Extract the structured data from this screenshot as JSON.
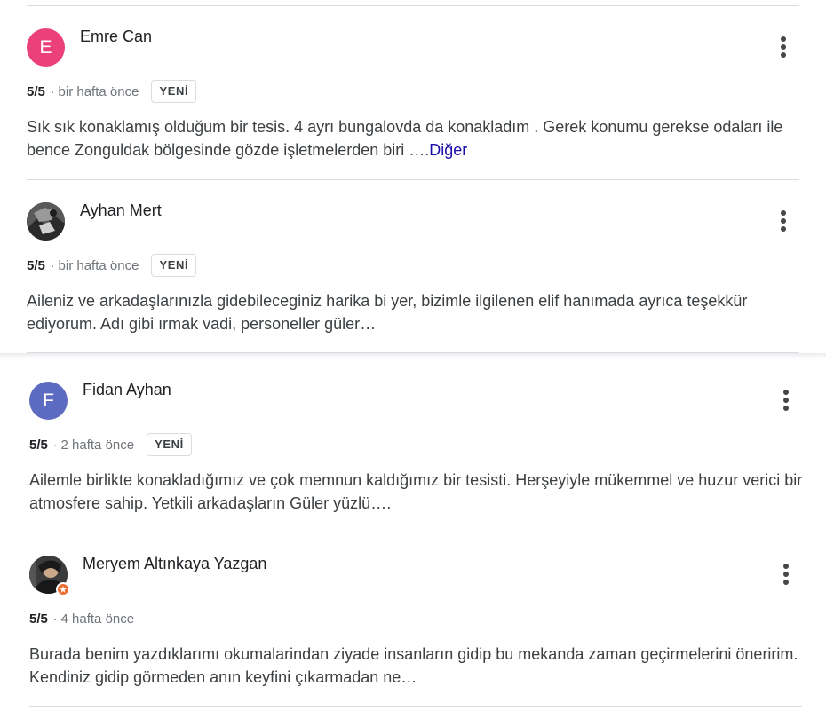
{
  "reviews": [
    {
      "author": "Emre Can",
      "avatar_letter": "E",
      "avatar_color": "#ec407a",
      "rating": "5/5",
      "separator": "·",
      "time": "bir hafta önce",
      "tag": "YENİ",
      "text": "Sık sık konaklamış olduğum bir tesis. 4 ayrı bungalovda da konakladım . Gerek konumu gerekse odaları ile bence Zonguldak bölgesinde gözde işletmelerden biri ….",
      "more_label": "Diğer",
      "more_icon": "more-vert-icon"
    },
    {
      "author": "Ayhan Mert",
      "avatar_letter": "",
      "avatar_color": "#3a3a3a",
      "rating": "5/5",
      "separator": "·",
      "time": "bir hafta önce",
      "tag": "YENİ",
      "text": "Aileniz ve arkadaşlarınızla gidebileceginiz harika bi yer, bizimle ilgilenen elif hanımada ayrıca teşekkür ediyorum. Adı gibi ırmak vadi, personeller güler…",
      "more_label": "",
      "more_icon": "more-vert-icon"
    },
    {
      "author": "Fidan Ayhan",
      "avatar_letter": "F",
      "avatar_color": "#5c6bc0",
      "rating": "5/5",
      "separator": "·",
      "time": "2 hafta önce",
      "tag": "YENİ",
      "text": "Ailemle birlikte konakladığımız ve çok memnun kaldığımız bir tesisti. Herşeyiyle mükemmel ve huzur verici bir atmosfere sahip. Yetkili arkadaşların Güler yüzlü….",
      "more_label": "",
      "more_icon": "more-vert-icon"
    },
    {
      "author": "Meryem Altınkaya Yazgan",
      "avatar_letter": "",
      "avatar_color": "#2b2b2b",
      "badge_color": "#ee6b2f",
      "rating": "5/5",
      "separator": "·",
      "time": "4 hafta önce",
      "tag": "",
      "text": "Burada benim yazdıklarımı okumalarindan ziyade insanların gidip bu mekanda zaman geçirmelerini öneririm. Kendiniz gidip görmeden anın keyfini çıkarmadan ne…",
      "more_label": "",
      "more_icon": "more-vert-icon"
    }
  ]
}
